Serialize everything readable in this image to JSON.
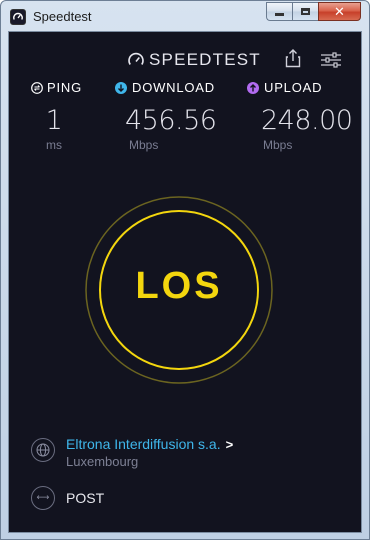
{
  "window": {
    "title": "Speedtest"
  },
  "header": {
    "brand": "SPEEDTEST",
    "icons": [
      "speedtest-logo-icon",
      "share-icon",
      "settings-icon"
    ]
  },
  "metrics": {
    "ping": {
      "label": "PING",
      "value": "1",
      "unit": "ms",
      "icon": "ping-icon",
      "color": "#ffffff"
    },
    "download": {
      "label": "DOWNLOAD",
      "value": "456.56",
      "unit": "Mbps",
      "icon": "download-arrow-icon",
      "color": "#3fb6ea"
    },
    "upload": {
      "label": "UPLOAD",
      "value": "248.00",
      "unit": "Mbps",
      "icon": "upload-arrow-icon",
      "color": "#b26bf0"
    }
  },
  "go_button": {
    "label": "LOS",
    "color": "#f3d60e"
  },
  "server": {
    "name": "Eltrona Interdiffusion s.a.",
    "chevron": ">",
    "location": "Luxembourg",
    "icon": "globe-icon"
  },
  "isp": {
    "name": "POST",
    "icon": "connection-icon"
  },
  "colors": {
    "background": "#12131f",
    "accent_yellow": "#f3d60e",
    "link_blue": "#3fb6ea",
    "muted_text": "#7a7d92"
  }
}
